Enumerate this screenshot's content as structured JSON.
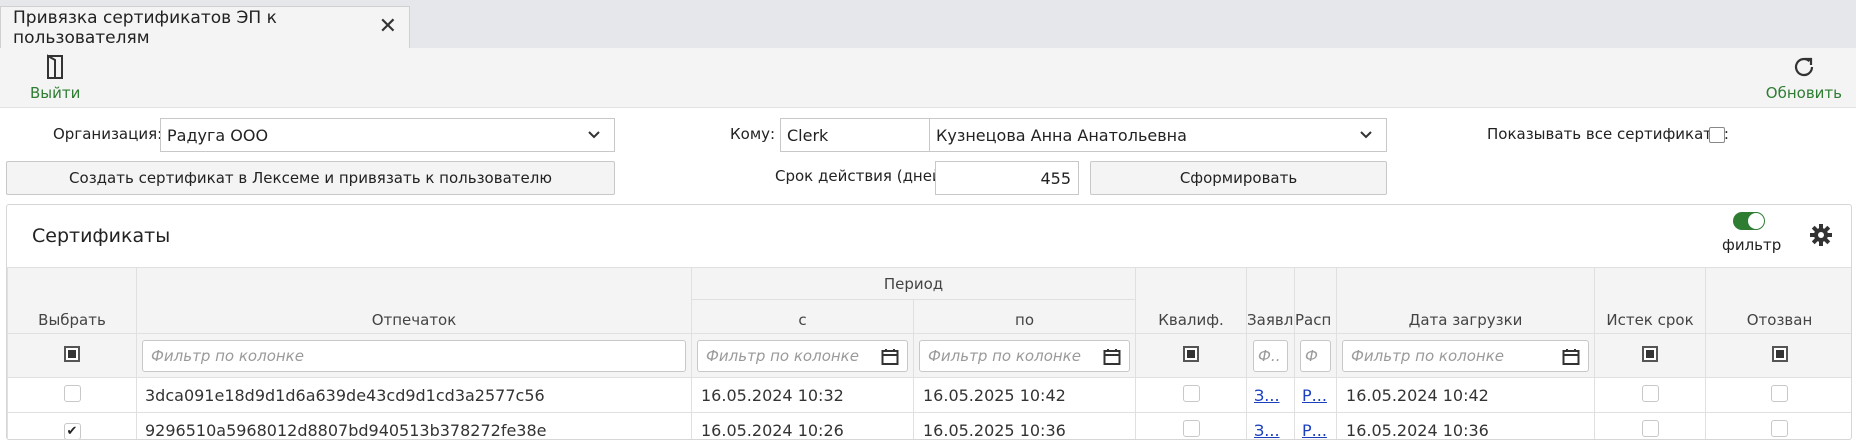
{
  "tab": {
    "title": "Привязка сертификатов ЭП к пользователям",
    "close": "✕"
  },
  "toolbar": {
    "exit_label": "Выйти",
    "refresh_label": "Обновить"
  },
  "form": {
    "org_label": "Организация:",
    "org_value": "Радуга ООО",
    "to_label": "Кому:",
    "to_login": "Clerk",
    "to_name": "Кузнецова Анна Анатольевна",
    "show_all_label": "Показывать все сертификаты:",
    "show_all_checked": false,
    "create_btn": "Создать сертификат в Лексеме и привязать к пользователю",
    "validity_label": "Срок действия (дней)",
    "validity_value": "455",
    "generate_btn": "Сформировать"
  },
  "panel": {
    "title": "Сертификаты",
    "filter_label": "фильтр",
    "filter_on": true
  },
  "table": {
    "headers": {
      "select": "Выбрать",
      "thumbprint": "Отпечаток",
      "period": "Период",
      "from": "с",
      "to": "по",
      "qualified": "Квалиф.",
      "application": "Заявл",
      "order": "Расп",
      "upload_date": "Дата загрузки",
      "expired": "Истек срок",
      "revoked": "Отозван"
    },
    "filter_placeholder": "Фильтр по колонке",
    "filter_short": "Ф..",
    "filter_letter": "Ф",
    "rows": [
      {
        "selected": false,
        "thumbprint": "3dca091e18d9d1d6a639de43cd9d1cd3a2577c56",
        "from": "16.05.2024 10:32",
        "to": "16.05.2025 10:42",
        "qualified": false,
        "application": "З...",
        "order": "Р...",
        "upload_date": "16.05.2024 10:42",
        "expired": false,
        "revoked": false
      },
      {
        "selected": true,
        "thumbprint": "9296510a5968012d8807bd940513b378272fe38e",
        "from": "16.05.2024 10:26",
        "to": "16.05.2025 10:36",
        "qualified": false,
        "application": "З...",
        "order": "Р...",
        "upload_date": "16.05.2024 10:36",
        "expired": false,
        "revoked": false
      }
    ]
  },
  "colors": {
    "accent": "#2e7d32",
    "link": "#1a3fbf"
  }
}
